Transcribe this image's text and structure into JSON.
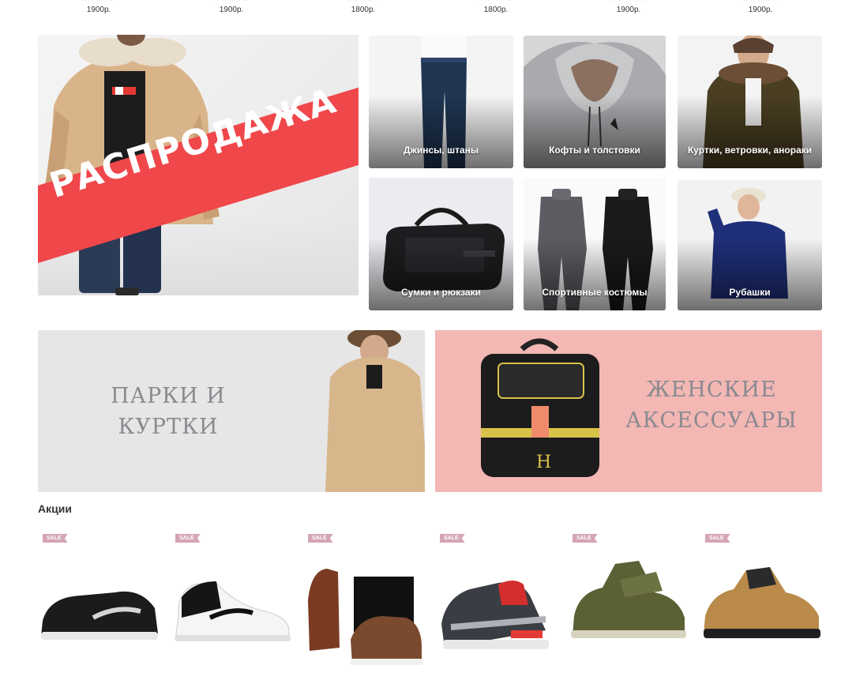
{
  "top_prices": [
    {
      "price": "1900р."
    },
    {
      "price": "1900р."
    },
    {
      "price": "1800р."
    },
    {
      "price": "1800р."
    },
    {
      "price": "1900р."
    },
    {
      "price": "1900р."
    }
  ],
  "sale_banner": {
    "text": "РАСПРОДАЖА"
  },
  "categories": [
    {
      "label": "Джинсы, штаны"
    },
    {
      "label": "Кофты и толстовки"
    },
    {
      "label": "Куртки, ветровки, анораки"
    },
    {
      "label": "Сумки и рюкзаки"
    },
    {
      "label": "Спортивные костюмы"
    },
    {
      "label": "Рубашки"
    }
  ],
  "banners": {
    "left": {
      "line1": "ПАРКИ И",
      "line2": "КУРТКИ"
    },
    "right": {
      "line1": "ЖЕНСКИЕ",
      "line2": "АКСЕССУАРЫ"
    }
  },
  "promo": {
    "title": "Акции",
    "badge": "SALE"
  },
  "colors": {
    "sale_red": "#f0474b",
    "badge_pink": "#d4a5b3",
    "banner_pink": "#f3b7b4"
  }
}
